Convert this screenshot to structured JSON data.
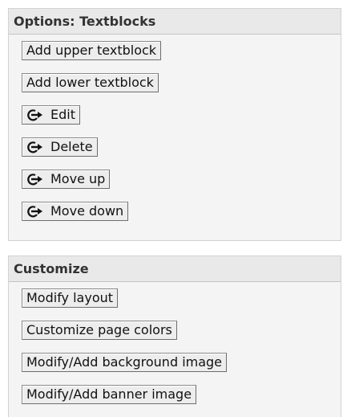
{
  "textblocks_panel": {
    "title": "Options: Textblocks",
    "buttons": [
      {
        "label": "Add upper textblock",
        "icon": null
      },
      {
        "label": "Add lower textblock",
        "icon": null
      },
      {
        "label": "Edit",
        "icon": "undo-arrow-icon"
      },
      {
        "label": "Delete",
        "icon": "undo-arrow-icon"
      },
      {
        "label": "Move up",
        "icon": "undo-arrow-icon"
      },
      {
        "label": "Move down",
        "icon": "undo-arrow-icon"
      }
    ]
  },
  "customize_panel": {
    "title": "Customize",
    "buttons": [
      {
        "label": "Modify layout"
      },
      {
        "label": "Customize page colors"
      },
      {
        "label": "Modify/Add background image"
      },
      {
        "label": "Modify/Add banner image"
      }
    ]
  }
}
